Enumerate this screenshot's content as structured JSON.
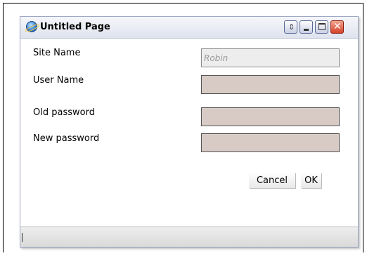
{
  "window": {
    "title": "Untitled Page",
    "controls": {
      "rollup": "rollup-icon",
      "minimize": "minimize-icon",
      "maximize": "maximize-icon",
      "close": "close-icon"
    }
  },
  "form": {
    "site_name": {
      "label": "Site Name",
      "value": "",
      "placeholder": "Robin"
    },
    "user_name": {
      "label": "User Name",
      "value": ""
    },
    "old_password": {
      "label": "Old password",
      "value": ""
    },
    "new_password": {
      "label": "New password",
      "value": ""
    }
  },
  "buttons": {
    "cancel": "Cancel",
    "ok": "OK"
  },
  "colors": {
    "field_fill": "#d8cbc6",
    "close_button": "#d4412a"
  }
}
